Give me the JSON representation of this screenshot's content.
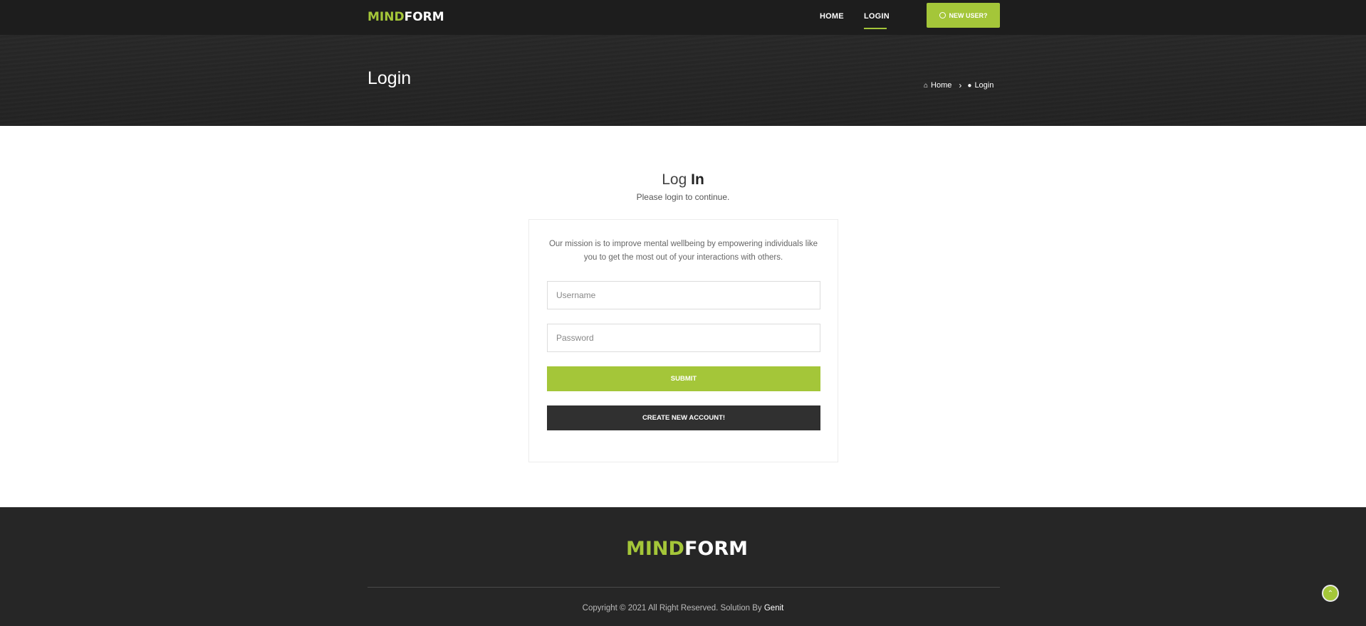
{
  "brand": {
    "logo_part1": "MIND",
    "logo_part2": "FORM",
    "accent": "#a4c639",
    "dark": "#262626"
  },
  "nav": {
    "home": "HOME",
    "login": "LOGIN",
    "new_user": "NEW USER?",
    "new_user_icon": "user-circle-icon"
  },
  "header": {
    "title": "Login",
    "breadcrumb": [
      {
        "label": "Home",
        "icon": "home-icon"
      },
      {
        "label": "Login",
        "icon": "user-icon"
      }
    ],
    "separator_icon": "chevron-right-icon"
  },
  "login": {
    "heading_light": "Log",
    "heading_bold": "In",
    "subtitle": "Please login to continue.",
    "mission": "Our mission is to improve mental wellbeing by empowering individuals like you to get the most out of your interactions with others.",
    "username_placeholder": "Username",
    "username_value": "",
    "password_placeholder": "Password",
    "password_value": "",
    "submit": "SUBMIT",
    "create": "CREATE NEW ACCOUNT!"
  },
  "footer": {
    "logo_part1": "MIND",
    "logo_part2": "FORM",
    "copyright": "Copyright © 2021 All Right Reserved. Solution By ",
    "company": "Genit",
    "scroll_top_icon": "chevron-up-icon"
  }
}
